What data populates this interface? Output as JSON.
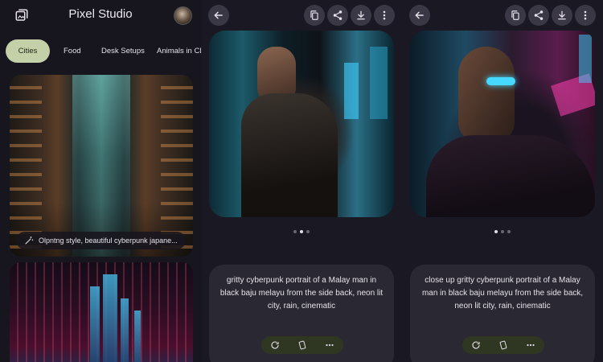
{
  "app": {
    "title": "Pixel Studio"
  },
  "chips": [
    "Cities",
    "Food",
    "Desk Setups",
    "Animals in Clo"
  ],
  "feed": {
    "card1_caption": "Olpntng style, beautiful cyberpunk japane..."
  },
  "detail_1": {
    "prompt": "gritty cyberpunk portrait of a Malay man in black baju melayu from the side back, neon lit city, rain, cinematic",
    "active_dot": 1
  },
  "detail_2": {
    "prompt": "close up gritty cyberpunk portrait of a Malay man in black baju melayu from the side back, neon lit city, rain, cinematic",
    "active_dot": 0
  },
  "icons": {
    "gallery": "gallery-icon",
    "back": "arrow-back-icon",
    "copy": "copy-icon",
    "share": "share-icon",
    "download": "download-icon",
    "more": "more-vert-icon",
    "regenerate": "refresh-icon",
    "edit": "edit-icon",
    "more_h": "more-horiz-icon",
    "magic": "magic-wand-icon"
  },
  "colors": {
    "background": "#18161f",
    "chip_selected": "#c4d0a7",
    "surface": "#2a2833",
    "action_pill": "#2f3622"
  }
}
